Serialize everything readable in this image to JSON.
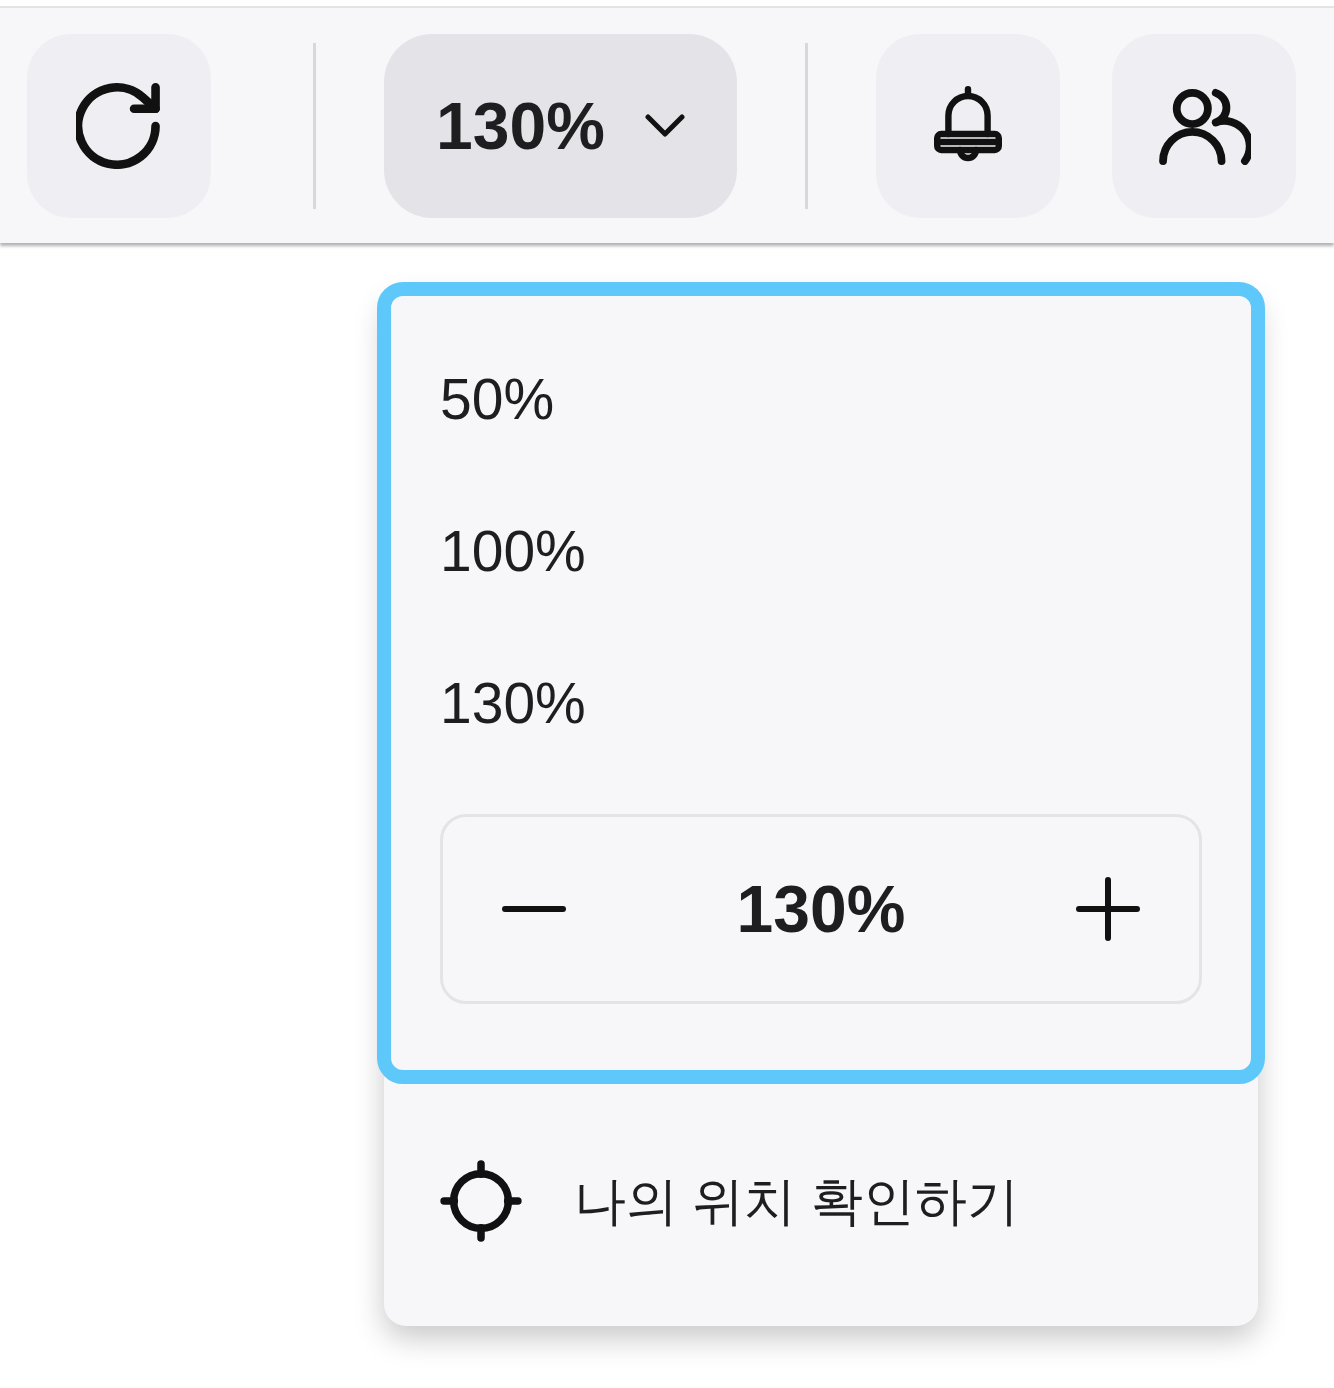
{
  "toolbar": {
    "zoom_select": {
      "value": "130%",
      "expanded": true
    }
  },
  "zoom_menu": {
    "focused": true,
    "options": [
      {
        "label": "50%"
      },
      {
        "label": "100%"
      },
      {
        "label": "130%"
      }
    ],
    "stepper": {
      "value": "130%"
    },
    "location_item": {
      "label": "나의 위치 확인하기"
    }
  }
}
